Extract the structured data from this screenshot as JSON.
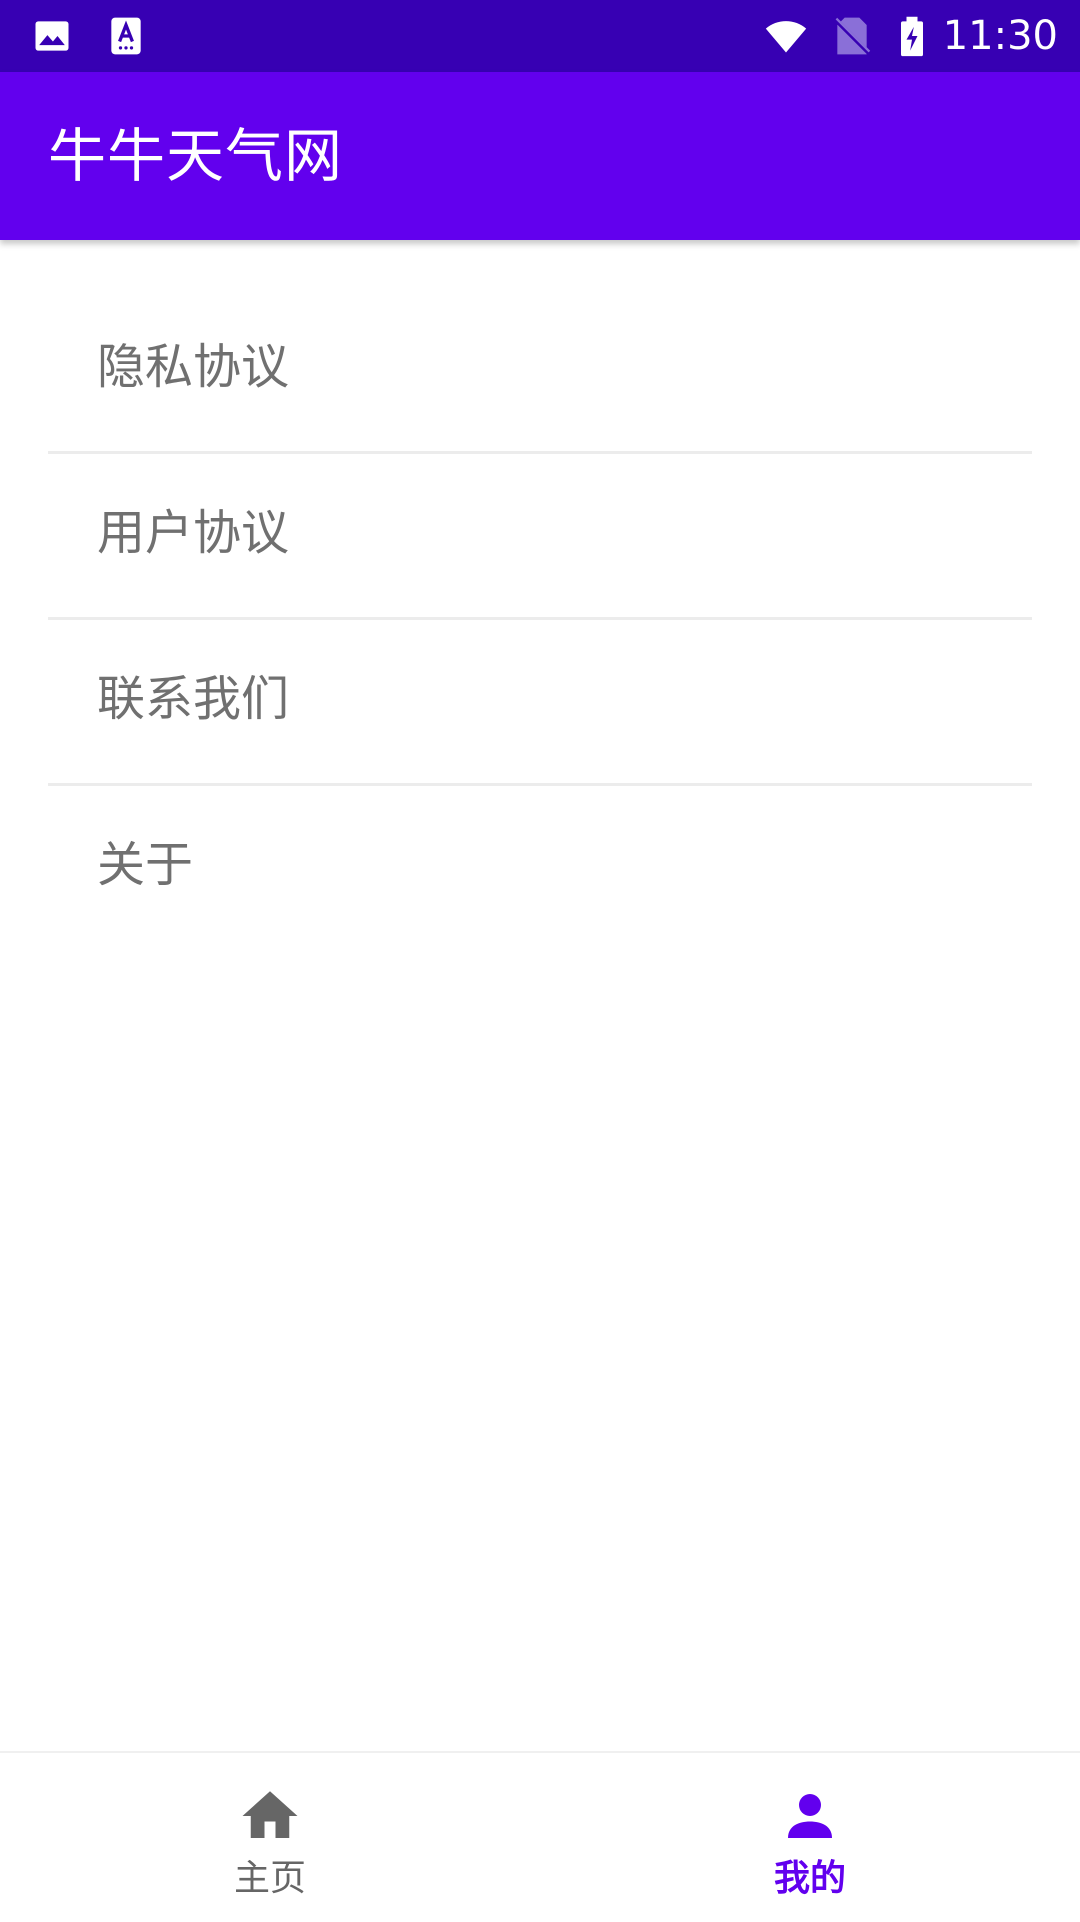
{
  "status_bar": {
    "time": "11:30",
    "icons": [
      "image-icon",
      "text-notification-icon",
      "wifi-icon",
      "no-sim-icon",
      "battery-charging-icon"
    ]
  },
  "app_bar": {
    "title": "牛牛天气网"
  },
  "menu": {
    "items": [
      {
        "label": "隐私协议"
      },
      {
        "label": "用户协议"
      },
      {
        "label": "联系我们"
      },
      {
        "label": "关于"
      }
    ]
  },
  "bottom_nav": {
    "items": [
      {
        "label": "主页",
        "icon": "home-icon",
        "selected": false
      },
      {
        "label": "我的",
        "icon": "person-icon",
        "selected": true
      }
    ]
  },
  "colors": {
    "status_bar": "#3700B3",
    "primary": "#6200EE",
    "menu_text": "#707070",
    "nav_inactive": "#666666"
  }
}
